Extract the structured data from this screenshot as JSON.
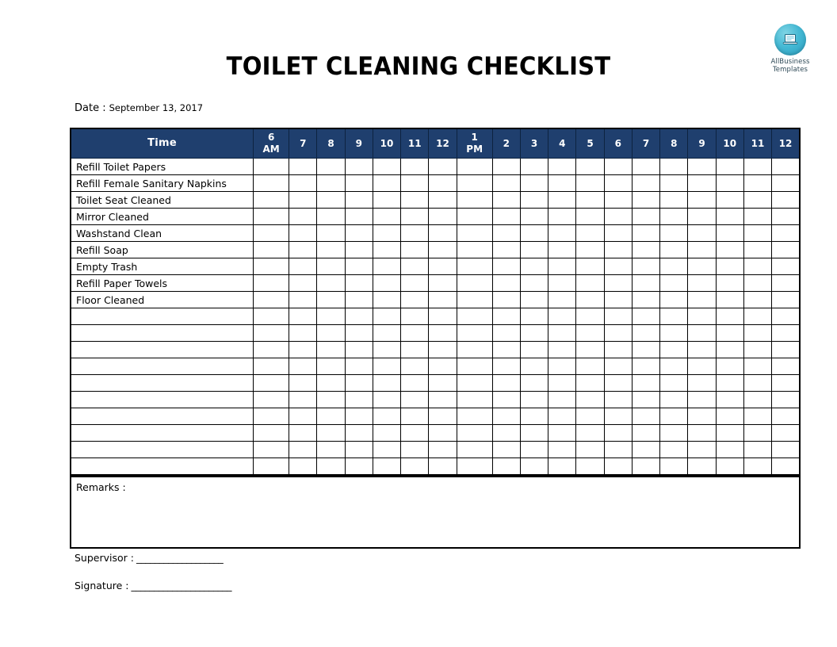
{
  "document": {
    "title": "TOILET CLEANING CHECKLIST"
  },
  "brand": {
    "icon": "laptop-document-icon",
    "line1": "AllBusiness",
    "line2": "Templates",
    "circle_color": "#45b9d4",
    "text_color": "#2f4a57"
  },
  "date_field": {
    "label": "Date :",
    "value": "September 13, 2017"
  },
  "table": {
    "header_bg": "#1f3f6e",
    "header_text_color": "#ffffff",
    "first_column_header": "Time",
    "hour_headers": [
      {
        "main": "6",
        "sub": "AM"
      },
      {
        "main": "7",
        "sub": ""
      },
      {
        "main": "8",
        "sub": ""
      },
      {
        "main": "9",
        "sub": ""
      },
      {
        "main": "10",
        "sub": ""
      },
      {
        "main": "11",
        "sub": ""
      },
      {
        "main": "12",
        "sub": ""
      },
      {
        "main": "1",
        "sub": "PM"
      },
      {
        "main": "2",
        "sub": ""
      },
      {
        "main": "3",
        "sub": ""
      },
      {
        "main": "4",
        "sub": ""
      },
      {
        "main": "5",
        "sub": ""
      },
      {
        "main": "6",
        "sub": ""
      },
      {
        "main": "7",
        "sub": ""
      },
      {
        "main": "8",
        "sub": ""
      },
      {
        "main": "9",
        "sub": ""
      },
      {
        "main": "10",
        "sub": ""
      },
      {
        "main": "11",
        "sub": ""
      },
      {
        "main": "12",
        "sub": ""
      }
    ],
    "tasks": [
      "Refill Toilet Papers",
      "Refill Female Sanitary Napkins",
      "Toilet Seat Cleaned",
      "Mirror Cleaned",
      "Washstand Clean",
      "Refill Soap",
      "Empty Trash",
      "Refill Paper Towels",
      "Floor Cleaned",
      "",
      "",
      "",
      "",
      "",
      "",
      "",
      "",
      "",
      ""
    ]
  },
  "remarks": {
    "label": "Remarks :",
    "value": ""
  },
  "signoff": {
    "supervisor_label": "Supervisor :",
    "supervisor_rule": "___________________",
    "signature_label": "Signature :",
    "signature_rule": "______________________"
  }
}
